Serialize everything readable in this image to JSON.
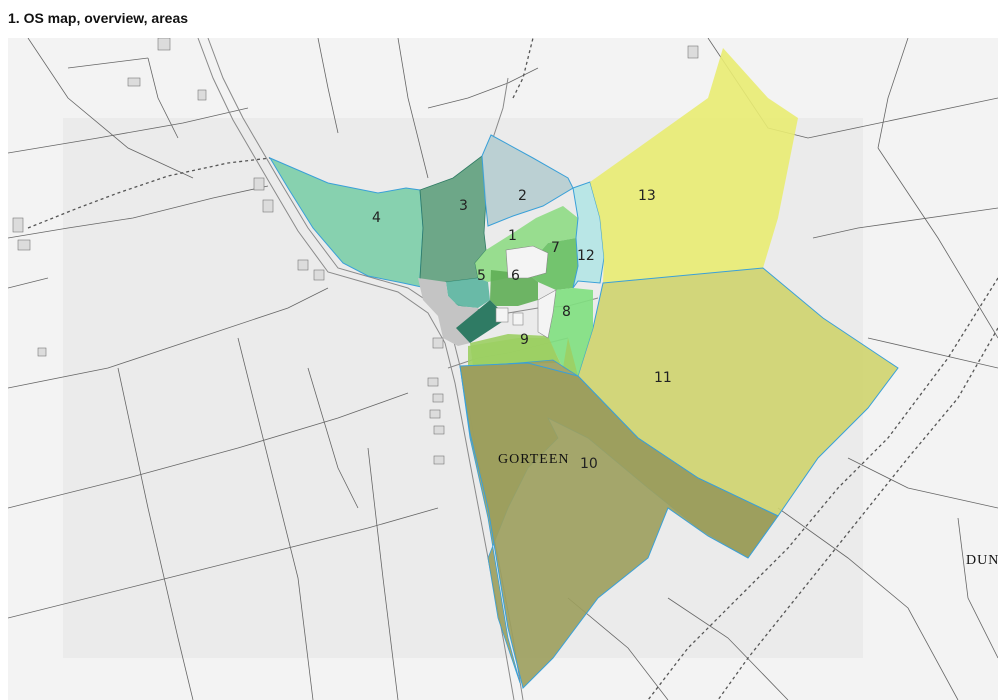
{
  "title": "1. OS map, overview, areas",
  "place_labels": {
    "townland": "GORTEEN",
    "edge": "DUN"
  },
  "areas": [
    {
      "id": "1",
      "label": "1",
      "color": "#8fdc85"
    },
    {
      "id": "2",
      "label": "2",
      "color": "#b6cdd0"
    },
    {
      "id": "3",
      "label": "3",
      "color": "#5fa07d"
    },
    {
      "id": "4",
      "label": "4",
      "color": "#7ccea8"
    },
    {
      "id": "5",
      "label": "5",
      "color": "#5bb5a0"
    },
    {
      "id": "6",
      "label": "6",
      "color": "#5fae55"
    },
    {
      "id": "7",
      "label": "7",
      "color": "#66c060"
    },
    {
      "id": "8",
      "label": "8",
      "color": "#7fe080"
    },
    {
      "id": "9",
      "label": "9",
      "color": "#9ccf63"
    },
    {
      "id": "10",
      "label": "10",
      "color": "#9c9f5d"
    },
    {
      "id": "11",
      "label": "11",
      "color": "#cfd46e"
    },
    {
      "id": "12",
      "label": "12",
      "color": "#b4e6e6"
    },
    {
      "id": "13",
      "label": "13",
      "color": "#e9ec72"
    }
  ],
  "colors": {
    "boundary": "#3aa0d8",
    "courtyard": "#c4c4c4",
    "dark_patch": "#2f7b64"
  }
}
